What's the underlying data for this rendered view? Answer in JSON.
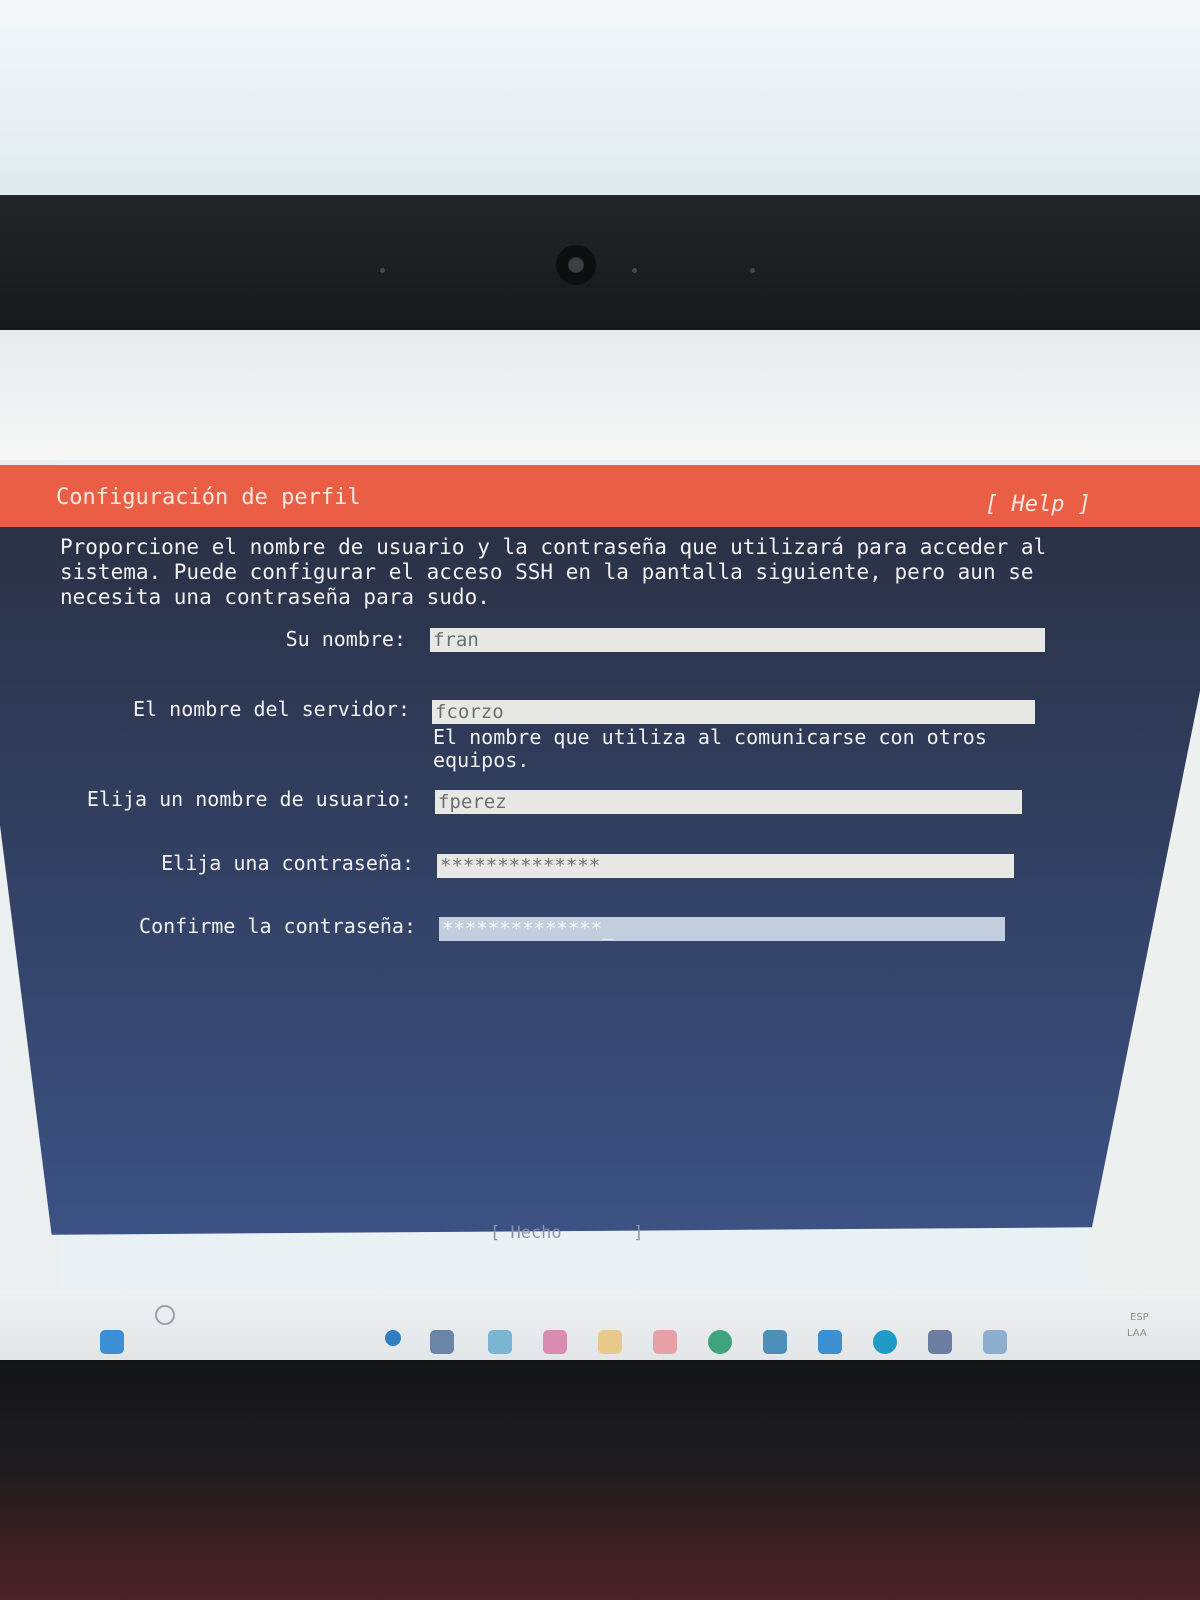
{
  "header": {
    "title": "Configuración de perfil",
    "help_label": "[ Help ]"
  },
  "intro": "Proporcione el nombre de usuario y la contraseña que utilizará para acceder al\nsistema. Puede configurar el acceso SSH en la pantalla siguiente, pero aun se\nnecesita una contraseña para sudo.",
  "form": {
    "name": {
      "label": "Su nombre:",
      "value": "fran"
    },
    "server": {
      "label": "El nombre del servidor:",
      "value": "fcorzo",
      "hint": "El nombre que utiliza al comunicarse con otros\nequipos."
    },
    "username": {
      "label": "Elija un nombre de usuario:",
      "value": "fperez"
    },
    "password": {
      "label": "Elija una contraseña:",
      "value": "**************"
    },
    "confirm": {
      "label": "Confirme la contraseña:",
      "value": "**************_"
    }
  },
  "done_label": "[ Hecho       ]",
  "taskbar": {
    "tray_language": "ESP",
    "tray_layout": "LAA",
    "icons": [
      "windows-start-icon",
      "search-icon",
      "chat-icon",
      "file-explorer-icon",
      "cloud-icon",
      "teams-icon",
      "folder-icon",
      "office-icon",
      "browser-icon",
      "store-icon",
      "vscode-icon",
      "edge-icon",
      "virtualbox-icon",
      "app-icon"
    ]
  },
  "colors": {
    "header_bg": "#e95e45",
    "panel_bg": "#324063",
    "field_bg": "#e7e7e3",
    "active_field_bg": "#c2cedd"
  }
}
